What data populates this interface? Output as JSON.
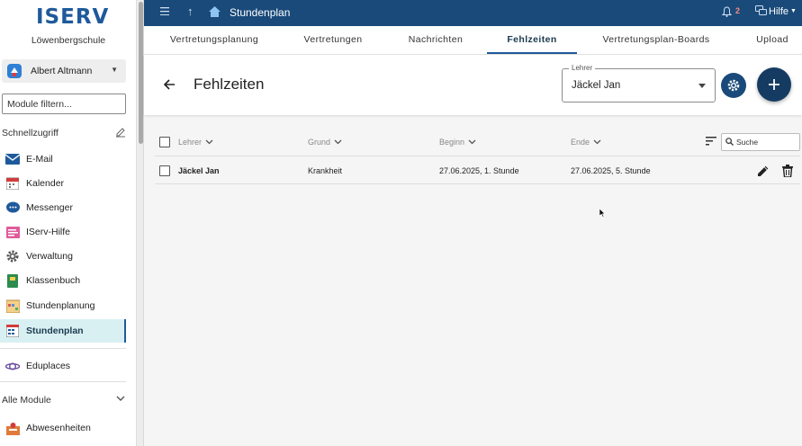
{
  "sidebar": {
    "logo": "ISERV",
    "school": "Löwenbergschule",
    "user_name": "Albert Altmann",
    "filter_placeholder": "Module filtern...",
    "quick_access_title": "Schnellzugriff",
    "items": [
      {
        "label": "E-Mail",
        "icon": "mail-icon"
      },
      {
        "label": "Kalender",
        "icon": "calendar-icon"
      },
      {
        "label": "Messenger",
        "icon": "messenger-icon"
      },
      {
        "label": "IServ-Hilfe",
        "icon": "help-book-icon"
      },
      {
        "label": "Verwaltung",
        "icon": "gear-icon"
      },
      {
        "label": "Klassenbuch",
        "icon": "classbook-icon"
      },
      {
        "label": "Stundenplanung",
        "icon": "planning-icon"
      },
      {
        "label": "Stundenplan",
        "icon": "timetable-icon",
        "active": true
      },
      {
        "label": "Eduplaces",
        "icon": "eduplaces-icon"
      }
    ],
    "all_modules_title": "Alle Module",
    "extra_items": [
      {
        "label": "Abwesenheiten",
        "icon": "absence-icon"
      }
    ]
  },
  "topbar": {
    "title": "Stundenplan",
    "notification_count": "2",
    "help_label": "Hilfe"
  },
  "tabs": [
    {
      "label": "Vertretungsplanung"
    },
    {
      "label": "Vertretungen"
    },
    {
      "label": "Nachrichten"
    },
    {
      "label": "Fehlzeiten",
      "active": true
    },
    {
      "label": "Vertretungsplan-Boards"
    },
    {
      "label": "Upload"
    }
  ],
  "header": {
    "title": "Fehlzeiten",
    "teacher_field_label": "Lehrer",
    "teacher_field_value": "Jäckel Jan"
  },
  "table": {
    "columns": [
      "Lehrer",
      "Grund",
      "Beginn",
      "Ende"
    ],
    "search_placeholder": "Suche",
    "rows": [
      {
        "lehrer": "Jäckel Jan",
        "grund": "Krankheit",
        "beginn": "27.06.2025, 1. Stunde",
        "ende": "27.06.2025, 5. Stunde"
      }
    ]
  },
  "colors": {
    "primary": "#194a7a",
    "active_nav_bg": "#d9f0f3",
    "badge": "#ff8a80"
  }
}
